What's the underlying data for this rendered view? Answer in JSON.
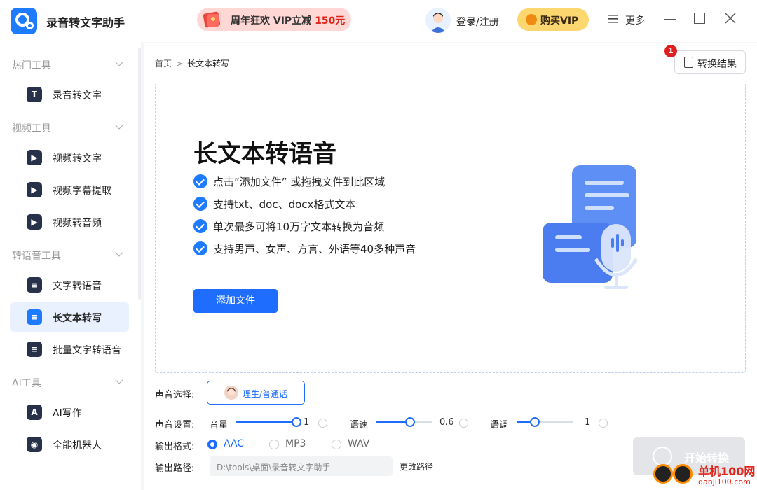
{
  "app": {
    "title": "录音转文字助手",
    "promo_text": "周年狂欢 VIP立减",
    "promo_amount": "150元",
    "login_label": "登录/注册",
    "vip_label": "购买VIP",
    "more_label": "更多"
  },
  "sidebar": {
    "sections": [
      {
        "title": "热门工具",
        "items": [
          {
            "label": "录音转文字",
            "icon": "T"
          }
        ]
      },
      {
        "title": "视频工具",
        "items": [
          {
            "label": "视频转文字",
            "icon": "▶"
          },
          {
            "label": "视频字幕提取",
            "icon": "▶"
          },
          {
            "label": "视频转音频",
            "icon": "▶"
          }
        ]
      },
      {
        "title": "转语音工具",
        "items": [
          {
            "label": "文字转语音",
            "icon": "≡"
          },
          {
            "label": "长文本转写",
            "icon": "≡",
            "active": true
          },
          {
            "label": "批量文字转语音",
            "icon": "≡"
          }
        ]
      },
      {
        "title": "AI工具",
        "items": [
          {
            "label": "AI写作",
            "icon": "A"
          },
          {
            "label": "全能机器人",
            "icon": "◉"
          }
        ]
      }
    ]
  },
  "breadcrumb": {
    "home": "首页",
    "sep": ">",
    "current": "长文本转写"
  },
  "result_button": {
    "label": "转换结果",
    "badge": "1"
  },
  "dropzone": {
    "title": "长文本转语音",
    "features": [
      "点击”添加文件” 或拖拽文件到此区域",
      "支持txt、doc、docx格式文本",
      "单次最多可将10万字文本转换为音频",
      "支持男声、女声、方言、外语等40多种声音"
    ],
    "add_button": "添加文件"
  },
  "settings": {
    "voice_label": "声音选择:",
    "voice_value": "理生/普通话",
    "sound_label": "声音设置:",
    "volume_label": "音量",
    "volume_value": "1",
    "volume_level": 1.0,
    "speed_label": "语速",
    "speed_value": "0.6",
    "speed_level": 0.6,
    "pitch_label": "语调",
    "pitch_value": "1",
    "pitch_level": 0.33,
    "format_label": "输出格式:",
    "formats": [
      "AAC",
      "MP3",
      "WAV"
    ],
    "format_selected": "AAC",
    "path_label": "输出路径:",
    "path_value": "D:\\tools\\桌面\\录音转文字助手",
    "change_path": "更改路径",
    "start_button": "开始转换"
  },
  "watermark": {
    "line1": "单机100网",
    "line2": "danji100.com"
  },
  "colors": {
    "accent": "#1e6dff",
    "brand": "#1e7bff",
    "badge": "#e02020",
    "vip": "#fcd66e"
  }
}
